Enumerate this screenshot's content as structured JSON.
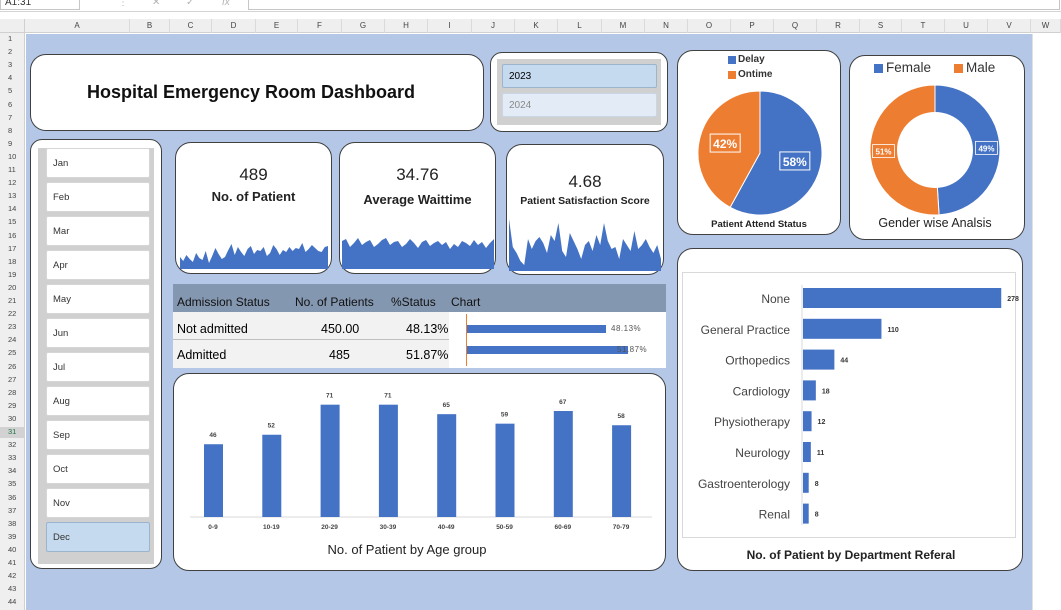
{
  "excel": {
    "name_box": "A1:31",
    "cancel": "✕",
    "confirm": "✓",
    "fx": "fx",
    "columns": [
      "A",
      "B",
      "C",
      "D",
      "E",
      "F",
      "G",
      "H",
      "I",
      "J",
      "K",
      "L",
      "M",
      "N",
      "O",
      "P",
      "Q",
      "R",
      "S",
      "T",
      "U",
      "V",
      "W"
    ],
    "rows": [
      "1",
      "2",
      "3",
      "4",
      "5",
      "6",
      "7",
      "8",
      "9",
      "10",
      "11",
      "12",
      "13",
      "14",
      "15",
      "16",
      "17",
      "18",
      "19",
      "20",
      "21",
      "22",
      "23",
      "24",
      "25",
      "26",
      "27",
      "28",
      "29",
      "30",
      "31",
      "32",
      "33",
      "34",
      "35",
      "36",
      "37",
      "38",
      "39",
      "40",
      "41",
      "42",
      "43",
      "44"
    ],
    "selected_row": "31"
  },
  "title": "Hospital Emergency Room Dashboard",
  "years": [
    "2023",
    "2024"
  ],
  "selected_year": "2023",
  "months": [
    "Jan",
    "Feb",
    "Mar",
    "Apr",
    "May",
    "Jun",
    "Jul",
    "Aug",
    "Sep",
    "Oct",
    "Nov",
    "Dec"
  ],
  "selected_month": "Dec",
  "kpis": {
    "patients": {
      "value": "489",
      "label": "No. of Patient"
    },
    "wait": {
      "value": "34.76",
      "label": "Average Waittime"
    },
    "satisfaction": {
      "value": "4.68",
      "label": "Patient Satisfaction Score"
    }
  },
  "admission": {
    "headers": [
      "Admission Status",
      "No. of Patients",
      "%Status",
      "Chart"
    ],
    "rows": [
      {
        "status": "Not admitted",
        "patients": "450.00",
        "pct": "48.13%",
        "bar_label": "48.13%",
        "fraction": 0.4813
      },
      {
        "status": "Admitted",
        "patients": "485",
        "pct": "51.87%",
        "bar_label": "51.87%",
        "fraction": 0.5187
      }
    ],
    "bar_color": "#4472c4"
  },
  "colors": {
    "blue": "#4472c4",
    "orange": "#ed7d31"
  },
  "chart_data": [
    {
      "type": "pie",
      "title": "Patient Attend Status",
      "legend": [
        "Delay",
        "Ontime"
      ],
      "legend_position": "top",
      "slices": [
        {
          "name": "Delay",
          "value": 58,
          "label": "58%"
        },
        {
          "name": "Ontime",
          "value": 42,
          "label": "42%"
        }
      ]
    },
    {
      "type": "pie",
      "title": "Gender wise Analsis",
      "donut": true,
      "legend": [
        "Female",
        "Male"
      ],
      "legend_position": "top",
      "slices": [
        {
          "name": "Female",
          "value": 49,
          "label": "49%"
        },
        {
          "name": "Male",
          "value": 51,
          "label": "51%"
        }
      ]
    },
    {
      "type": "bar",
      "title": "No. of Patient by Age group",
      "categories": [
        "0-9",
        "10-19",
        "20-29",
        "30-39",
        "40-49",
        "50-59",
        "60-69",
        "70-79"
      ],
      "values": [
        46,
        52,
        71,
        71,
        65,
        59,
        67,
        58
      ],
      "ylim": [
        0,
        75
      ],
      "grid": false
    },
    {
      "type": "bar",
      "orientation": "horizontal",
      "title": "No. of Patient by Department Referal",
      "categories": [
        "None",
        "General Practice",
        "Orthopedics",
        "Cardiology",
        "Physiotherapy",
        "Neurology",
        "Gastroenterology",
        "Renal"
      ],
      "values": [
        278,
        110,
        44,
        18,
        12,
        11,
        8,
        8
      ],
      "xlim": [
        0,
        290
      ]
    }
  ]
}
